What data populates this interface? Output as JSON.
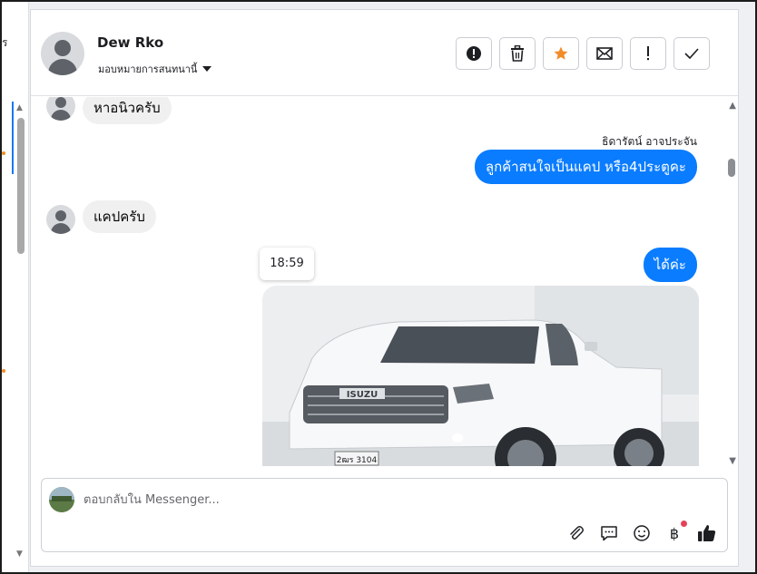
{
  "left_panel": {
    "fragment_text": "ร"
  },
  "conversation": {
    "contact_name": "Dew Rko",
    "assign_label": "มอบหมายการสนทนานี้",
    "actions": [
      {
        "icon": "alert-circle-icon",
        "title": "spam"
      },
      {
        "icon": "trash-icon",
        "title": "delete"
      },
      {
        "icon": "star-icon",
        "title": "star"
      },
      {
        "icon": "envelope-icon",
        "title": "mark-unread"
      },
      {
        "icon": "exclamation-icon",
        "title": "follow-up"
      },
      {
        "icon": "check-icon",
        "title": "done"
      }
    ],
    "accent_color": "#0a7cff",
    "star_color": "#f28c28"
  },
  "messages": {
    "incoming_1": "หาอนิวครับ",
    "sender_name": "ธิดารัตน์ อาจประจัน",
    "outgoing_1": "ลูกค้าสนใจเป็นแคป หรือ4ประตูคะ",
    "incoming_2": "แคปครับ",
    "timestamp": "18:59",
    "outgoing_2": "ได้ค่ะ",
    "photo": {
      "brand_text": "ISUZU",
      "plate_text": "2ฒร 3104"
    }
  },
  "composer": {
    "placeholder": "ตอบกลับใน Messenger...",
    "tools": [
      "paperclip-icon",
      "chat-bubble-icon",
      "smiley-icon",
      "baht-icon",
      "thumbs-up-icon"
    ]
  }
}
